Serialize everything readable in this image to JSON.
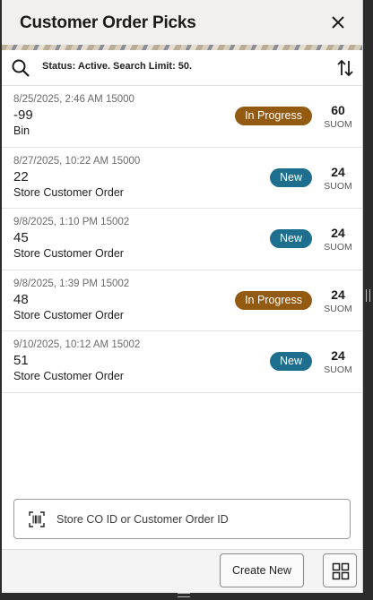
{
  "header": {
    "title": "Customer Order Picks"
  },
  "toolbar": {
    "status_text": "Status: Active. Search Limit: 50."
  },
  "orders": [
    {
      "meta": "8/25/2025, 2:46 AM 15000",
      "number": "-99",
      "type": "Bin",
      "status": "In Progress",
      "qty": "60",
      "uom": "SUOM"
    },
    {
      "meta": "8/27/2025, 10:22 AM 15000",
      "number": "22",
      "type": "Store Customer Order",
      "status": "New",
      "qty": "24",
      "uom": "SUOM"
    },
    {
      "meta": "9/8/2025, 1:10 PM 15002",
      "number": "45",
      "type": "Store Customer Order",
      "status": "New",
      "qty": "24",
      "uom": "SUOM"
    },
    {
      "meta": "9/8/2025, 1:39 PM 15002",
      "number": "48",
      "type": "Store Customer Order",
      "status": "In Progress",
      "qty": "24",
      "uom": "SUOM"
    },
    {
      "meta": "9/10/2025, 10:12 AM 15002",
      "number": "51",
      "type": "Store Customer Order",
      "status": "New",
      "qty": "24",
      "uom": "SUOM"
    }
  ],
  "scan": {
    "placeholder": "Store CO ID or Customer Order ID"
  },
  "footer": {
    "create_label": "Create New"
  },
  "colors": {
    "in_progress": "#935a11",
    "new": "#1e6e8e"
  },
  "icons": {
    "close": "close-icon",
    "search": "search-icon",
    "sort": "sort-icon",
    "barcode": "barcode-scan-icon",
    "grid": "grid-icon"
  }
}
